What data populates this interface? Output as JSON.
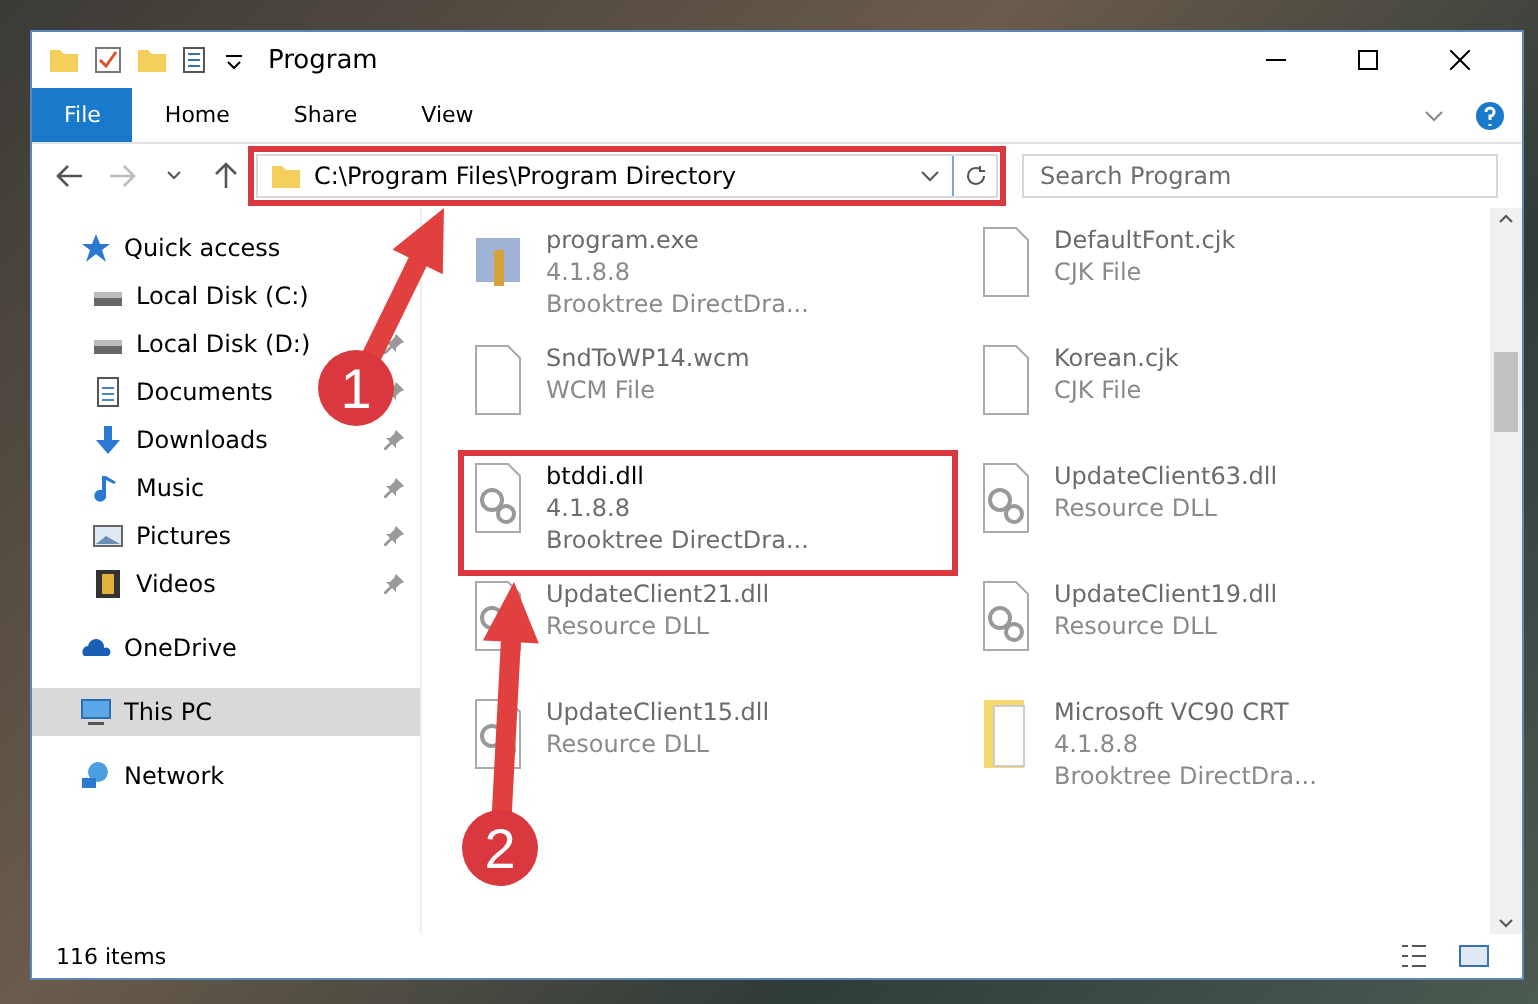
{
  "window": {
    "title": "Program"
  },
  "ribbon_tabs": [
    {
      "label": "File",
      "selected": true
    },
    {
      "label": "Home",
      "selected": false
    },
    {
      "label": "Share",
      "selected": false
    },
    {
      "label": "View",
      "selected": false
    }
  ],
  "address": {
    "path": "C:\\Program Files\\Program Directory",
    "highlighted": true
  },
  "search": {
    "placeholder": "Search Program"
  },
  "nav": [
    {
      "label": "Quick access",
      "kind": "star",
      "pinned": false,
      "selected": false,
      "children": [
        {
          "label": "Local Disk (C:)",
          "kind": "drive",
          "selected": false
        },
        {
          "label": "Local Disk (D:)",
          "kind": "drive",
          "pinned": true,
          "selected": false
        },
        {
          "label": "Documents",
          "kind": "doc",
          "pinned": true,
          "selected": false
        },
        {
          "label": "Downloads",
          "kind": "download",
          "pinned": true,
          "selected": false
        },
        {
          "label": "Music",
          "kind": "music",
          "pinned": true,
          "selected": false
        },
        {
          "label": "Pictures",
          "kind": "picture",
          "pinned": true,
          "selected": false
        },
        {
          "label": "Videos",
          "kind": "video",
          "pinned": true,
          "selected": false
        }
      ]
    },
    {
      "label": "OneDrive",
      "kind": "cloud",
      "pinned": false,
      "selected": false
    },
    {
      "label": "This PC",
      "kind": "pc",
      "pinned": false,
      "selected": true
    },
    {
      "label": "Network",
      "kind": "network",
      "pinned": false,
      "selected": false
    }
  ],
  "files": [
    {
      "name": "program.exe",
      "details": [
        "4.1.8.8",
        "Brooktree DirectDra..."
      ],
      "kind": "exe",
      "dimmed": true,
      "highlighted": false
    },
    {
      "name": "DefaultFont.cjk",
      "details": [
        "CJK File"
      ],
      "kind": "blank",
      "dimmed": true,
      "highlighted": false
    },
    {
      "name": "SndToWP14.wcm",
      "details": [
        "WCM File"
      ],
      "kind": "blank",
      "dimmed": true,
      "highlighted": false
    },
    {
      "name": "Korean.cjk",
      "details": [
        "CJK File"
      ],
      "kind": "blank",
      "dimmed": true,
      "highlighted": false
    },
    {
      "name": "btddi.dll",
      "details": [
        "4.1.8.8",
        "Brooktree DirectDra..."
      ],
      "kind": "dll",
      "dimmed": false,
      "highlighted": true
    },
    {
      "name": "UpdateClient63.dll",
      "details": [
        "Resource DLL"
      ],
      "kind": "dll",
      "dimmed": true,
      "highlighted": false
    },
    {
      "name": "UpdateClient21.dll",
      "details": [
        "Resource DLL"
      ],
      "kind": "dll",
      "dimmed": true,
      "highlighted": false
    },
    {
      "name": "UpdateClient19.dll",
      "details": [
        "Resource DLL"
      ],
      "kind": "dll",
      "dimmed": true,
      "highlighted": false
    },
    {
      "name": "UpdateClient15.dll",
      "details": [
        "Resource DLL"
      ],
      "kind": "dll",
      "dimmed": true,
      "highlighted": false
    },
    {
      "name": "Microsoft VC90 CRT",
      "details": [
        "4.1.8.8",
        "Brooktree DirectDra..."
      ],
      "kind": "package",
      "dimmed": true,
      "highlighted": false
    }
  ],
  "status_bar": {
    "count": "116 items"
  },
  "callouts": [
    {
      "number": "1"
    },
    {
      "number": "2"
    }
  ]
}
